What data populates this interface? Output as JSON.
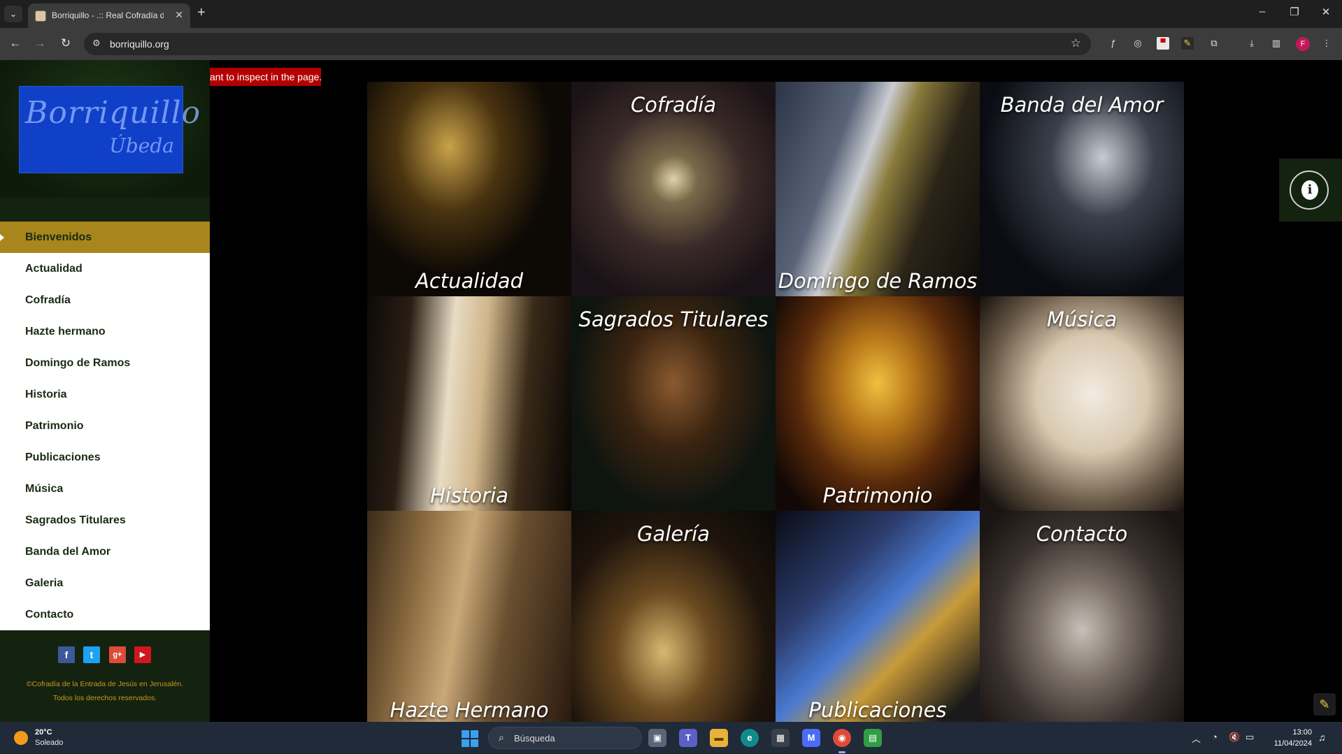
{
  "browser": {
    "tab_title": "Borriquillo - .:: Real Cofradía de",
    "url": "borriquillo.org",
    "profile_initial": "F"
  },
  "page": {
    "logo": {
      "script": "Borriquillo",
      "city": "Úbeda"
    },
    "inspect_tooltip": "ant to inspect in the page.",
    "menu": [
      "Bienvenidos",
      "Actualidad",
      "Cofradía",
      "Hazte hermano",
      "Domingo de Ramos",
      "Historia",
      "Patrimonio",
      "Publicaciones",
      "Música",
      "Sagrados Titulares",
      "Banda del Amor",
      "Galeria",
      "Contacto"
    ],
    "active_menu": "Bienvenidos",
    "social": {
      "facebook": "f",
      "twitter": "t",
      "googleplus": "g+",
      "youtube": "▶"
    },
    "footer": {
      "line1": "©Cofradía de la Entrada de Jesús en Jerusalén.",
      "line2": "Todos los derechos reservados."
    },
    "tiles": [
      {
        "label": "Actualidad",
        "position": "bottom"
      },
      {
        "label": "Cofradía",
        "position": "top"
      },
      {
        "label": "Domingo de Ramos",
        "position": "bottom"
      },
      {
        "label": "Banda del Amor",
        "position": "top"
      },
      {
        "label": "Historia",
        "position": "bottom"
      },
      {
        "label": "Sagrados Titulares",
        "position": "top"
      },
      {
        "label": "Patrimonio",
        "position": "bottom"
      },
      {
        "label": "Música",
        "position": "top"
      },
      {
        "label": "Hazte Hermano",
        "position": "bottom"
      },
      {
        "label": "Galería",
        "position": "top"
      },
      {
        "label": "Publicaciones",
        "position": "bottom"
      },
      {
        "label": "Contacto",
        "position": "top"
      }
    ]
  },
  "taskbar": {
    "weather_temp": "20°C",
    "weather_desc": "Soleado",
    "search_placeholder": "Búsqueda",
    "time": "13:00",
    "date": "11/04/2024"
  }
}
